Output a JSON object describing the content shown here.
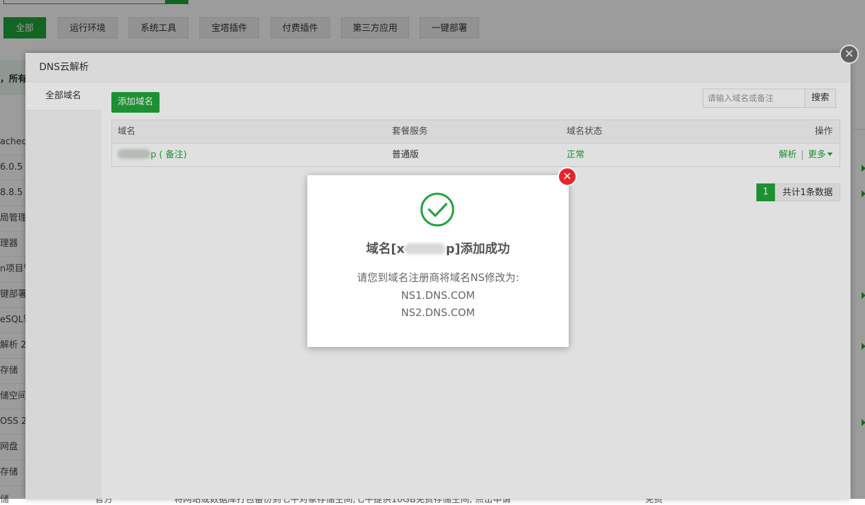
{
  "background": {
    "category_tabs": [
      "全部",
      "运行环境",
      "系统工具",
      "宝塔插件",
      "付费插件",
      "第三方应用",
      "一键部署"
    ],
    "notice_text": "，所有",
    "sidebar_fragments": [
      "ached",
      "6.0.5",
      "8.8.5",
      "局管理",
      "理器",
      "n项目管",
      "键部署",
      "eSQL管",
      "解析 2.",
      "存储",
      "储空间",
      "OSS 2.",
      "网盘",
      "存储"
    ],
    "bottom_row": [
      "储",
      "官方",
      "将网站或数据库打包备份到七牛对象存储空间,七牛提供10GB免费存储空间, 点击申请",
      "免费"
    ]
  },
  "dns_layer": {
    "title": "DNS云解析",
    "close_icon": "close-icon",
    "sidebar_item": "全部域名",
    "add_button": "添加域名",
    "search_placeholder": "请输入域名或备注",
    "search_button": "搜索",
    "table": {
      "headers": [
        "域名",
        "套餐服务",
        "域名状态",
        "操作"
      ],
      "rows": [
        {
          "domain_suffix": "p",
          "remark": "( 备注)",
          "plan": "普通版",
          "status": "正常",
          "action_resolve": "解析",
          "action_separator": "|",
          "action_more": "更多"
        }
      ]
    },
    "pagination": {
      "current": "1",
      "total": "共计1条数据"
    }
  },
  "success_dialog": {
    "title_prefix": "域名[x",
    "title_suffix": "p]添加成功",
    "message": "请您到域名注册商将域名NS修改为:",
    "ns1": "NS1.DNS.COM",
    "ns2": "NS2.DNS.COM",
    "icon": "check-circle-icon",
    "accent_color": "#20a53a",
    "close_color": "#e7232c"
  }
}
